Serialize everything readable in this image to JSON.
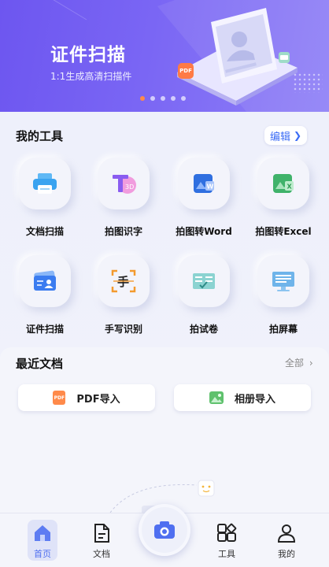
{
  "banner": {
    "title": "证件扫描",
    "subtitle": "1:1生成高清扫描件",
    "badge": "PDF",
    "page_count": 5,
    "active_page": 1
  },
  "tools": {
    "title": "我的工具",
    "edit_label": "编辑",
    "items": [
      {
        "label": "文档扫描",
        "icon": "printer-icon"
      },
      {
        "label": "拍图识字",
        "icon": "text-recognition-icon"
      },
      {
        "label": "拍图转Word",
        "icon": "word-icon"
      },
      {
        "label": "拍图转Excel",
        "icon": "excel-icon"
      },
      {
        "label": "证件扫描",
        "icon": "id-card-icon"
      },
      {
        "label": "手写识别",
        "icon": "handwriting-icon"
      },
      {
        "label": "拍试卷",
        "icon": "exam-paper-icon"
      },
      {
        "label": "拍屏幕",
        "icon": "screen-icon"
      }
    ]
  },
  "recent": {
    "title": "最近文档",
    "all_label": "全部",
    "pdf_import": "PDF导入",
    "pdf_badge": "PDF",
    "album_import": "相册导入"
  },
  "nav": {
    "items": [
      {
        "label": "首页",
        "icon": "home-icon",
        "active": true
      },
      {
        "label": "文档",
        "icon": "document-icon"
      },
      {
        "label": "",
        "icon": "camera-icon"
      },
      {
        "label": "工具",
        "icon": "tools-grid-icon"
      },
      {
        "label": "我的",
        "icon": "profile-icon"
      }
    ]
  },
  "colors": {
    "accent": "#3b6cf6",
    "banner": "#7a66f4",
    "pager_active": "#ff8a4a"
  }
}
